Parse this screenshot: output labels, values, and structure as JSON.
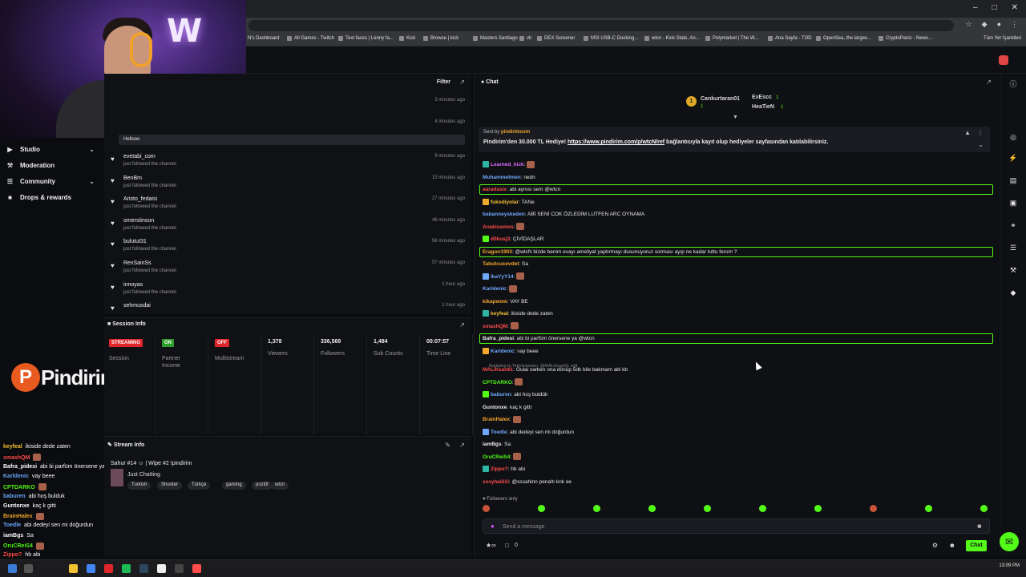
{
  "browser": {
    "bookmarks": [
      "N's Dashboard",
      "All Games - Twitch",
      "Text faces | Lenny fa...",
      "Kick",
      "Browse | kick",
      "Masters Santiago",
      "vlr",
      "DEX Screener",
      "MSI USB-C Docking...",
      "wtcn - Kick Stats, An...",
      "Polymarket | The W...",
      "Ana Sayfa - TOD",
      "OpenSea, the larges...",
      "CryptoPanic - News..."
    ],
    "other_bookmarks": "Tüm Yer İşaretleri"
  },
  "sidebar": {
    "items": [
      {
        "label": "Studio",
        "icon": "video-icon",
        "expandable": true
      },
      {
        "label": "Moderation",
        "icon": "wrench-icon",
        "expandable": false
      },
      {
        "label": "Community",
        "icon": "community-icon",
        "expandable": true
      },
      {
        "label": "Drops & rewards",
        "icon": "gift-icon",
        "expandable": false
      }
    ]
  },
  "overlay": {
    "brand": "Pindirim",
    "brand_initial": "P",
    "chat": [
      {
        "user": "keyfeal",
        "msg": "ikiside dede zaten",
        "color": "#f1c232"
      },
      {
        "user": "smashQM",
        "msg": "",
        "color": "#ff4d4d"
      },
      {
        "user": "Bafra_pidesi",
        "msg": "abi bi parfüm önersene ya @wtcn",
        "color": "#ffffff"
      },
      {
        "user": "Karldenic",
        "msg": "vay beee",
        "color": "#6fa8ff"
      },
      {
        "user": "CPTDARKO",
        "msg": "",
        "color": "#53fc18"
      },
      {
        "user": "baburen",
        "msg": "abi hoş bulduk",
        "color": "#6fa8ff"
      },
      {
        "user": "Guntonxe",
        "msg": "kaç k gitti",
        "color": "#ffffff"
      },
      {
        "user": "BrainHalex",
        "msg": "",
        "color": "#f3a72f"
      },
      {
        "user": "Toedle",
        "msg": "abi dedeyi sen mi doğurdun",
        "color": "#6fa8ff"
      },
      {
        "user": "iamBgs",
        "msg": "Sa",
        "color": "#ffffff"
      },
      {
        "user": "OruCReiS4",
        "msg": "",
        "color": "#53fc18"
      },
      {
        "user": "Zippo?",
        "msg": "hb abi",
        "color": "#ff4d4d"
      },
      {
        "user": "",
        "msg": "@sssahinn penaltı knk ee",
        "color": "#ffffff"
      }
    ]
  },
  "activity": {
    "filter_label": "Filter",
    "hellooo": "Hellooo",
    "top_times": [
      "3 minutes ago",
      "4 minutes ago"
    ],
    "feed": [
      {
        "name": "evetabi_com",
        "sub": "just followed the channel",
        "time": "9 minutes ago"
      },
      {
        "name": "BenBm",
        "sub": "just followed the channel",
        "time": "15 minutes ago"
      },
      {
        "name": "Aristo_fedaisi",
        "sub": "just followed the channel",
        "time": "27 minutes ago"
      },
      {
        "name": "omerstinson",
        "sub": "just followed the channel",
        "time": "46 minutes ago"
      },
      {
        "name": "bulutut31",
        "sub": "just followed the channel",
        "time": "56 minutes ago"
      },
      {
        "name": "RexSainSs",
        "sub": "just followed the channel",
        "time": "57 minutes ago"
      },
      {
        "name": "innoyas",
        "sub": "just followed the channel",
        "time": "1 hour ago"
      },
      {
        "name": "sehmusdai",
        "sub": "",
        "time": "1 hour ago"
      }
    ]
  },
  "session": {
    "title": "Session Info",
    "cols": [
      {
        "badge": "STREAMING",
        "badge_color": "#e0262b",
        "label": "Session"
      },
      {
        "badge": "ON",
        "badge_color": "#2e9e2a",
        "label": "Partner\nIncome"
      },
      {
        "badge": "OFF",
        "badge_color": "#e0262b",
        "label": "Multistream"
      },
      {
        "value": "1,378",
        "label": "Viewers"
      },
      {
        "value": "336,569",
        "label": "Followers"
      },
      {
        "value": "1,484",
        "label": "Sub Counts"
      },
      {
        "value": "00:07:57",
        "label": "Time Live"
      }
    ]
  },
  "stream_info": {
    "title": "Stream Info",
    "stream_title": "Sahur #14 ☺ | Wipe #2 !pindirim",
    "category": "Just Chatting",
    "tags": [
      "Turkish",
      "Shooter",
      "Türkçe",
      "gaming",
      "pozitif",
      "wtcn"
    ]
  },
  "chat": {
    "title": "Chat",
    "leaderboard": [
      {
        "name": "Cankurtaran01",
        "count": "1",
        "color": "#f3a72f"
      },
      {
        "name": "ExEscc",
        "count": "1",
        "color": "#eeeeee"
      },
      {
        "name": "HeaTieN",
        "count": "1",
        "color": "#f3a72f"
      }
    ],
    "pinned": {
      "sent_by": "Sent by",
      "sender": "pindirimcom",
      "text_before": "Pindirim'den 30.000 TL Hediye! ",
      "link": "https://www.pindirim.com/p/wtcN/ref",
      "text_after": " bağlantısıyla kayıt olup hediyeler sayfasından katılabilirsiniz."
    },
    "messages": [
      {
        "user": "Learned_kick",
        "msg": "",
        "color": "#d96bff",
        "emote": true
      },
      {
        "user": "Muhammetmen",
        "msg": "nedn",
        "color": "#6fa8ff"
      },
      {
        "user": "aaradasix",
        "msg": "abi aynısı sem @wtcn",
        "color": "#ff4d4d",
        "highlight": true
      },
      {
        "user": "fukodiyolar",
        "msg": "TANe",
        "color": "#f1c232"
      },
      {
        "user": "babanneyskeden",
        "msg": "ABİ SENİ COK ÖZLEDİM LUTFEN ARC OYNAMA",
        "color": "#6fa8ff"
      },
      {
        "user": "Anakiusmos",
        "msg": "",
        "color": "#ff4d4d",
        "emote": true
      },
      {
        "user": "d0kusj3",
        "msg": "ÇİVİDAŞLAR",
        "color": "#ff4d4d"
      },
      {
        "user": "Eragon1903",
        "msg": "@wtcN bizde benim evayı ameliyat yaptırmayı dusunuyoruz sorması ayıp ne kadar tuttu ferom ?",
        "color": "#f3a72f",
        "highlight": true
      },
      {
        "user": "Tabutcucevdet",
        "msg": "Sa",
        "color": "#f3a72f"
      },
      {
        "user": "IkaYyY14",
        "msg": "",
        "color": "#6fa8ff",
        "emote": true
      },
      {
        "user": "Karldenic",
        "msg": "",
        "color": "#6fa8ff",
        "emote": true
      },
      {
        "user": "kikapwow",
        "msg": "VAY BE",
        "color": "#f3a72f"
      },
      {
        "user": "keyfeal",
        "msg": "ikiside dede zaten",
        "color": "#f1c232"
      },
      {
        "user": "smashQM",
        "msg": "",
        "color": "#ff4d4d",
        "emote": true
      },
      {
        "user": "Bafra_pidesi",
        "msg": "abi bi parfüm önersene ya @wtcn",
        "color": "#eeeeee",
        "highlight": true
      },
      {
        "user": "Karldenic",
        "msg": "vay beee",
        "color": "#6fa8ff"
      },
      {
        "user": "MALihsan61",
        "msg": "Oulai varken ona dönüp 5dk bile bakmam abi kb",
        "color": "#ff4d4d"
      },
      {
        "user": "CPTDARKO",
        "msg": "",
        "color": "#53fc18",
        "emote": true
      },
      {
        "user": "baburen",
        "msg": "abi hoş buldük",
        "color": "#6fa8ff"
      },
      {
        "user": "Guntonxe",
        "msg": "kaç k gitti",
        "color": "#eeeeee"
      },
      {
        "user": "BrainHalex",
        "msg": "",
        "color": "#f3a72f",
        "emote": true
      },
      {
        "user": "Toedle",
        "msg": "abi dedeyi sen mi doğurdun",
        "color": "#6fa8ff"
      },
      {
        "user": "iamBgs",
        "msg": "Sa",
        "color": "#eeeeee"
      },
      {
        "user": "OruCReiS4",
        "msg": "",
        "color": "#53fc18",
        "emote": true
      },
      {
        "user": "Zippo?",
        "msg": "hb abi",
        "color": "#ff4d4d"
      },
      {
        "user": "sssyhaliiiii",
        "msg": "@sssahinn penaltı knk ee",
        "color": "#ff4d4d"
      }
    ],
    "reply_note": "Replying to Tekelcisnamı: @MALihsan61 xdd",
    "followers_only": "Followers only",
    "input_placeholder": "Send a message",
    "bottom_count": "0",
    "bottom_count_2": "0",
    "send_label": "Chat"
  },
  "taskbar": {
    "time": "13:09 PM"
  }
}
